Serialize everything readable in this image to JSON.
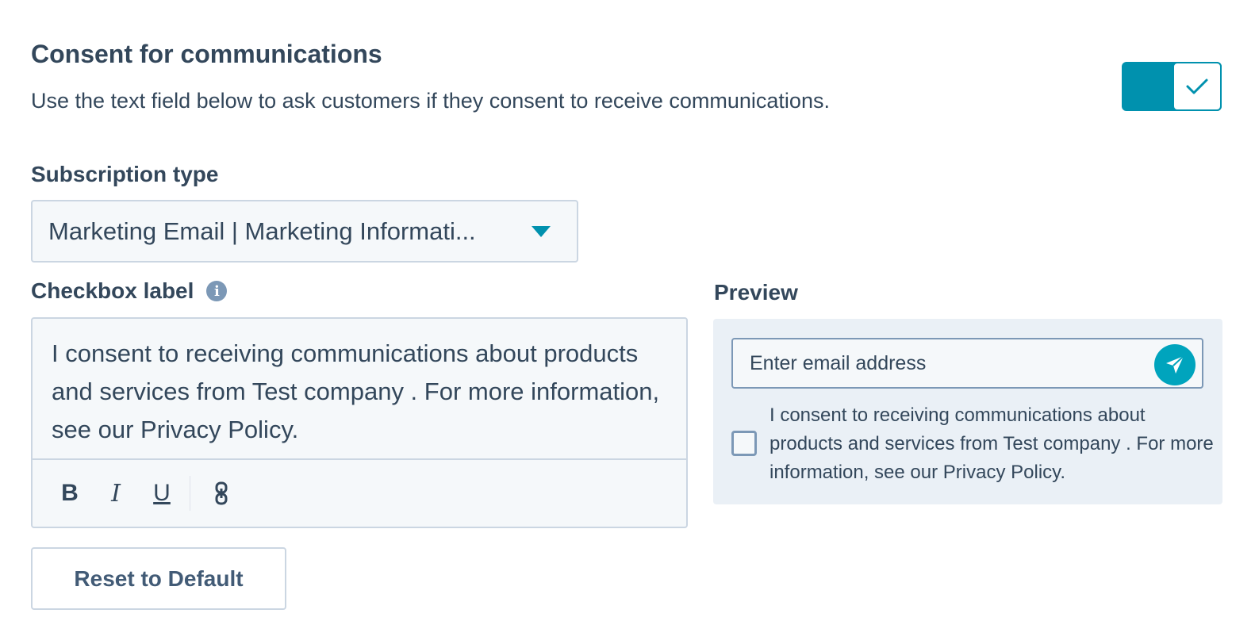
{
  "consent": {
    "title": "Consent for communications",
    "description": "Use the text field below to ask customers if they consent to receive communications.",
    "toggle_on": true
  },
  "subscription": {
    "label": "Subscription type",
    "selected": "Marketing Email | Marketing Informati..."
  },
  "checkbox_label": {
    "label": "Checkbox label",
    "text": "I consent to receiving communications about products and services from Test company . For more information, see our Privacy Policy.",
    "toolbar": {
      "bold": "B",
      "italic": "I",
      "underline": "U"
    }
  },
  "reset_button": "Reset to Default",
  "preview": {
    "label": "Preview",
    "email_placeholder": "Enter email address",
    "consent_text": "I consent to receiving communications about products and services from Test company . For more information, see our Privacy Policy."
  },
  "colors": {
    "accent": "#0091ae",
    "send_button": "#00a4bd",
    "text": "#33475b",
    "border": "#cbd6e2",
    "preview_bg": "#eaf0f6"
  },
  "icons": [
    "check-icon",
    "caret-down-icon",
    "info-icon",
    "bold-icon",
    "italic-icon",
    "underline-icon",
    "link-icon",
    "send-icon"
  ]
}
